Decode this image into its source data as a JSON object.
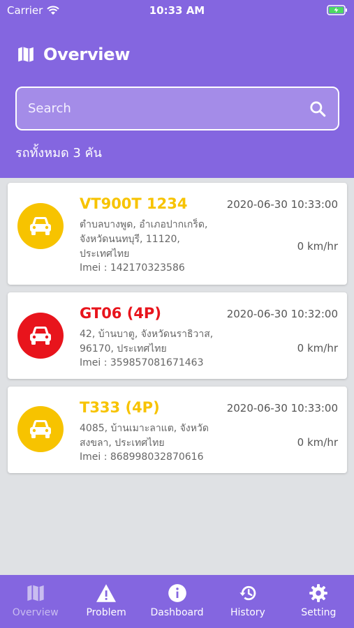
{
  "status": {
    "carrier": "Carrier",
    "time": "10:33 AM"
  },
  "header": {
    "title": "Overview",
    "search_placeholder": "Search",
    "total": "รถทั้งหมด 3 คัน"
  },
  "colors": {
    "brand": "#8466e0",
    "yellow": "#f7c300",
    "red": "#e8141c"
  },
  "vehicles": [
    {
      "name": "VT900T 1234",
      "status_color": "#f7c300",
      "date": "2020-06-30 10:33:00",
      "address_lines": [
        "ตำบลบางพูด, อำเภอปากเกร็ด,",
        "จังหวัดนนทบุรี, 11120,",
        "ประเทศไทย"
      ],
      "speed": "0 km/hr",
      "imei": "Imei : 142170323586"
    },
    {
      "name": "GT06 (4P)",
      "status_color": "#e8141c",
      "date": "2020-06-30 10:32:00",
      "address_lines": [
        "42, บ้านบาตู, จังหวัดนราธิวาส,",
        "96170, ประเทศไทย"
      ],
      "speed": "0 km/hr",
      "imei": "Imei : 359857081671463"
    },
    {
      "name": "T333 (4P)",
      "status_color": "#f7c300",
      "date": "2020-06-30 10:33:00",
      "address_lines": [
        "4085, บ้านเมาะลาแต, จังหวัด",
        "สงขลา, ประเทศไทย"
      ],
      "speed": "0 km/hr",
      "imei": "Imei : 868998032870616"
    }
  ],
  "tabs": [
    {
      "label": "Overview",
      "icon": "map-icon",
      "active": true
    },
    {
      "label": "Problem",
      "icon": "warning-icon",
      "active": false
    },
    {
      "label": "Dashboard",
      "icon": "info-icon",
      "active": false
    },
    {
      "label": "History",
      "icon": "history-icon",
      "active": false
    },
    {
      "label": "Setting",
      "icon": "gear-icon",
      "active": false
    }
  ]
}
